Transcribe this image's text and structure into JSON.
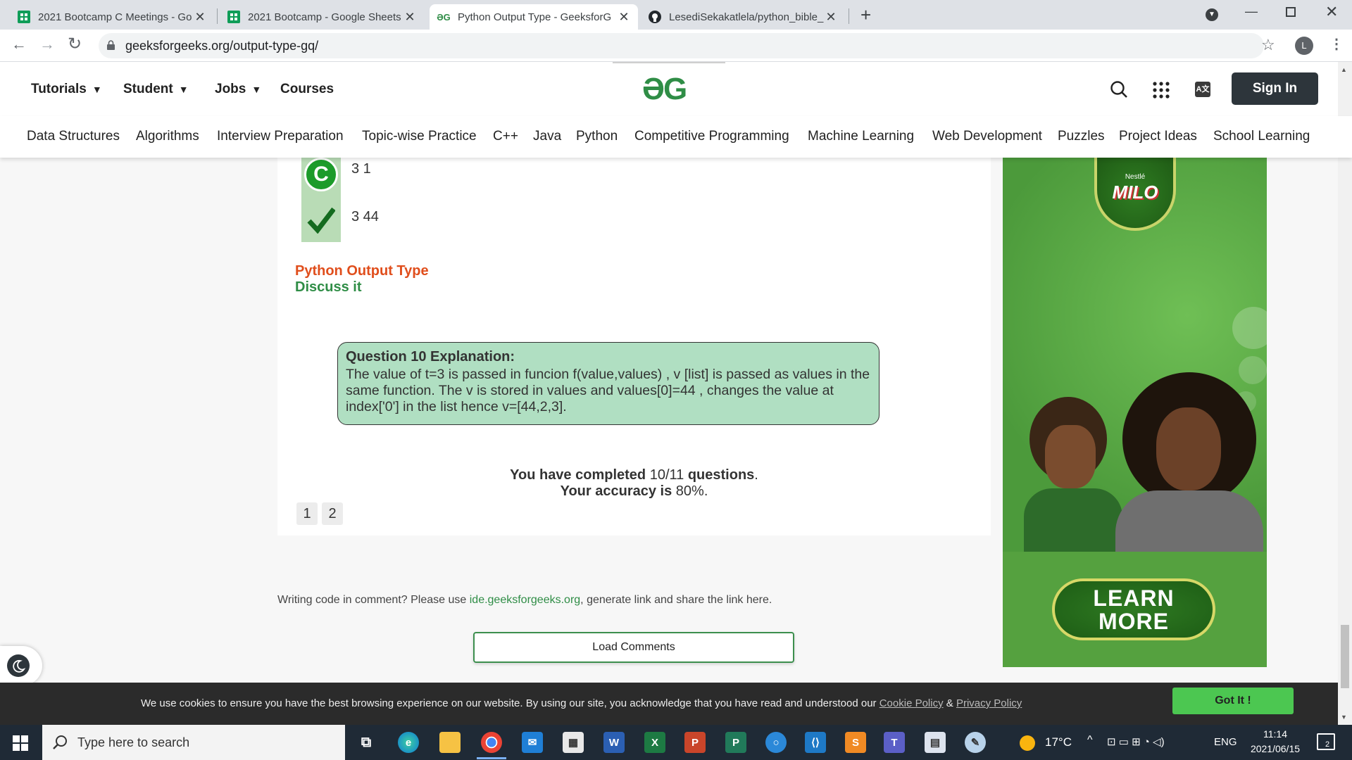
{
  "browser": {
    "tabs": [
      {
        "label": "2021 Bootcamp C Meetings - Go",
        "icon": "sheets-icon",
        "active": false
      },
      {
        "label": "2021 Bootcamp - Google Sheets",
        "icon": "sheets-icon",
        "active": false
      },
      {
        "label": "Python Output Type - GeeksforG",
        "icon": "gfg-icon",
        "active": true
      },
      {
        "label": "LesediSekakatlela/python_bible_",
        "icon": "github-icon",
        "active": false
      }
    ],
    "url": "geeksforgeeks.org/output-type-gq/",
    "profile_initial": "L"
  },
  "nav": {
    "tutorials": "Tutorials",
    "student": "Student",
    "jobs": "Jobs",
    "courses": "Courses",
    "logo_text": "ƏG",
    "sign_in": "Sign In"
  },
  "subnav": [
    "Data Structures",
    "Algorithms",
    "Interview Preparation",
    "Topic-wise Practice",
    "C++",
    "Java",
    "Python",
    "Competitive Programming",
    "Machine Learning",
    "Web Development",
    "Puzzles",
    "Project Ideas",
    "School Learning"
  ],
  "quiz": {
    "option_c_letter": "C",
    "option_c_text": "3 1",
    "option_d_text": "3 44",
    "topic_link": "Python Output Type",
    "discuss_link": "Discuss it",
    "explanation_title": "Question 10 Explanation:",
    "explanation_body": "The value of t=3 is passed in funcion f(value,values) , v [list] is passed as values in the same function. The v is stored in values and values[0]=44 , changes the value at index['0'] in the list hence v=[44,2,3].",
    "completed_prefix": "You have completed",
    "completed_count": "10/11",
    "completed_suffix": "questions",
    "accuracy_prefix": "Your accuracy is",
    "accuracy_value": "80%",
    "pages": [
      "1",
      "2"
    ]
  },
  "comments": {
    "note_prefix": "Writing code in comment? Please use",
    "note_link": "ide.geeksforgeeks.org",
    "note_suffix": ", generate link and share the link here.",
    "load_button": "Load Comments"
  },
  "ad": {
    "brand_small": "Nestlé",
    "brand": "MILO",
    "cta_line1": "LEARN",
    "cta_line2": "MORE"
  },
  "cookie": {
    "text": "We use cookies to ensure you have the best browsing experience on our website. By using our site, you acknowledge that you have read and understood our",
    "cookie_policy": "Cookie Policy",
    "amp": "&",
    "privacy_policy": "Privacy Policy",
    "got_it": "Got It !"
  },
  "taskbar": {
    "search_placeholder": "Type here to search",
    "temperature": "17°C",
    "language": "ENG",
    "time": "11:14",
    "date": "2021/06/15",
    "notif_count": "2"
  },
  "colors": {
    "gfg_green": "#2f8d46",
    "orange_link": "#e04e1c",
    "ad_green": "#4c9a3b",
    "cookie_button": "#4cc751"
  }
}
